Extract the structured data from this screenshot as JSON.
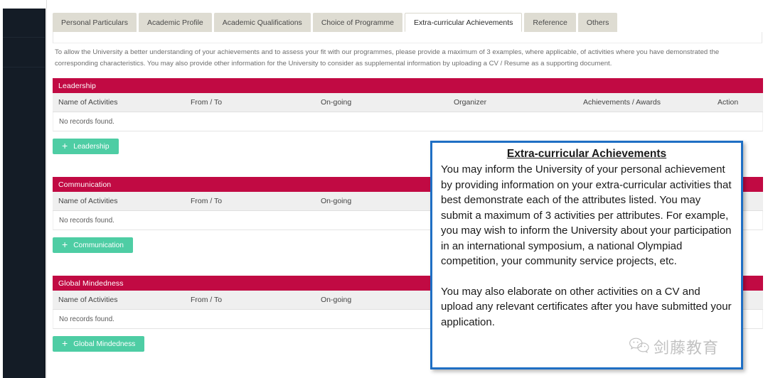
{
  "tabs": [
    {
      "label": "Personal Particulars",
      "active": false
    },
    {
      "label": "Academic Profile",
      "active": false
    },
    {
      "label": "Academic Qualifications",
      "active": false
    },
    {
      "label": "Choice of Programme",
      "active": false
    },
    {
      "label": "Extra-curricular Achievements",
      "active": true
    },
    {
      "label": "Reference",
      "active": false
    },
    {
      "label": "Others",
      "active": false
    }
  ],
  "intro": "To allow the University a better understanding of your achievements and to assess your fit with our programmes, please provide a maximum of 3 examples, where applicable, of activities where you have demonstrated the corresponding characteristics. You may also provide other information for the University to consider as supplemental information by uploading a CV / Resume as a supporting document.",
  "columns": {
    "name": "Name of Activities",
    "from_to": "From / To",
    "ongoing": "On-going",
    "organizer": "Organizer",
    "achievements": "Achievements / Awards",
    "action": "Action"
  },
  "empty_text": "No records found.",
  "add_icon": "plus-icon",
  "sections": [
    {
      "title": "Leadership",
      "add_label": "Leadership"
    },
    {
      "title": "Communication",
      "add_label": "Communication"
    },
    {
      "title": "Global Mindedness",
      "add_label": "Global Mindedness"
    }
  ],
  "callout": {
    "title": "Extra-curricular Achievements",
    "paragraph1": "You may inform the University of your personal achievement by providing information on your extra-curricular activities that best demonstrate each of the attributes listed. You may submit a maximum of 3 activities per attributes. For example, you may wish to inform the University about your participation in an international symposium, a national Olympiad competition, your community service projects, etc.",
    "paragraph2": "You may also elaborate on other activities on a CV and upload any relevant certificates after you have submitted your application."
  },
  "watermark": {
    "icon": "wechat-icon",
    "text": "剑藤教育"
  },
  "colors": {
    "section_header": "#c10a43",
    "add_button": "#4ecda4",
    "callout_border": "#1f6fc4",
    "tab_inactive": "#dedcd2",
    "sidebar": "#141c26",
    "table_header": "#efefef"
  }
}
